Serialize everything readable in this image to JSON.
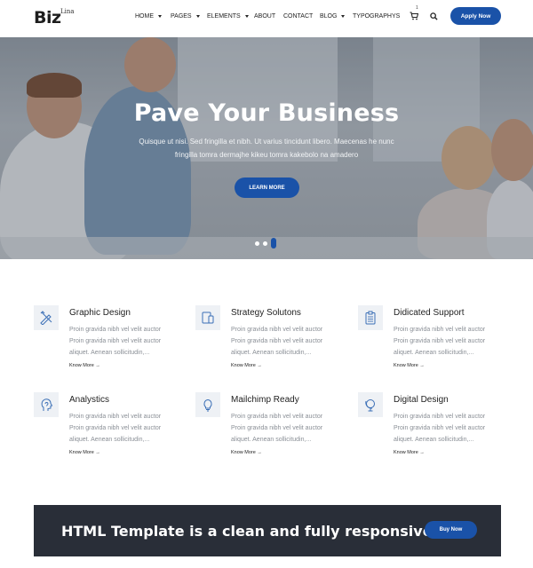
{
  "brand": {
    "logo": "Biz",
    "logo_sup": "Lina"
  },
  "nav": {
    "items": [
      {
        "label": "HOME",
        "has_caret": true
      },
      {
        "label": "PAGES",
        "has_caret": true
      },
      {
        "label": "ELEMENTS",
        "has_caret": true
      },
      {
        "label": "ABOUT",
        "has_caret": false
      },
      {
        "label": "CONTACT",
        "has_caret": false
      },
      {
        "label": "BLOG",
        "has_caret": true
      },
      {
        "label": "TYPOGRAPHYS",
        "has_caret": false
      }
    ],
    "cart_count": "1",
    "cart_icon": "cart-icon",
    "search_icon": "search-icon",
    "apply_label": "Apply Now"
  },
  "hero": {
    "title": "Pave Your Business",
    "subtitle_line1": "Quisque ut nisi. Sed fringilla et nibh. Ut varius tincidunt libero. Maecenas he nunc",
    "subtitle_line2": "fringilla tomra dermajhe kikeu tomra kakebolo na amadero",
    "button_label": "LEARN MORE",
    "slides_total": 3,
    "active_slide": 3
  },
  "services": [
    {
      "title": "Graphic Design",
      "icon": "pencil-ruler-icon",
      "text": "Proin gravida nibh vel velit auctor Proin gravida nibh vel velit auctor aliquet. Aenean sollicitudin,...",
      "more": "Know More →"
    },
    {
      "title": "Strategy Solutons",
      "icon": "devices-icon",
      "text": "Proin gravida nibh vel velit auctor Proin gravida nibh vel velit auctor aliquet. Aenean sollicitudin,...",
      "more": "Know More →"
    },
    {
      "title": "Didicated Support",
      "icon": "clipboard-icon",
      "text": "Proin gravida nibh vel velit auctor Proin gravida nibh vel velit auctor aliquet. Aenean sollicitudin,...",
      "more": "Know More →"
    },
    {
      "title": "Analystics",
      "icon": "head-idea-icon",
      "text": "Proin gravida nibh vel velit auctor Proin gravida nibh vel velit auctor aliquet. Aenean sollicitudin,...",
      "more": "Know More →"
    },
    {
      "title": "Mailchimp Ready",
      "icon": "lightbulb-icon",
      "text": "Proin gravida nibh vel velit auctor Proin gravida nibh vel velit auctor aliquet. Aenean sollicitudin,...",
      "more": "Know More →"
    },
    {
      "title": "Digital Design",
      "icon": "globe-stand-icon",
      "text": "Proin gravida nibh vel velit auctor Proin gravida nibh vel velit auctor aliquet. Aenean sollicitudin,...",
      "more": "Know More →"
    }
  ],
  "cta": {
    "text": "HTML Template is a clean and fully responsive.",
    "button_label": "Buy Now"
  },
  "colors": {
    "accent": "#1a52a8",
    "cta_bg": "#292e38",
    "icon_box_bg": "#eef1f5",
    "icon_stroke": "#3b6fb6"
  }
}
